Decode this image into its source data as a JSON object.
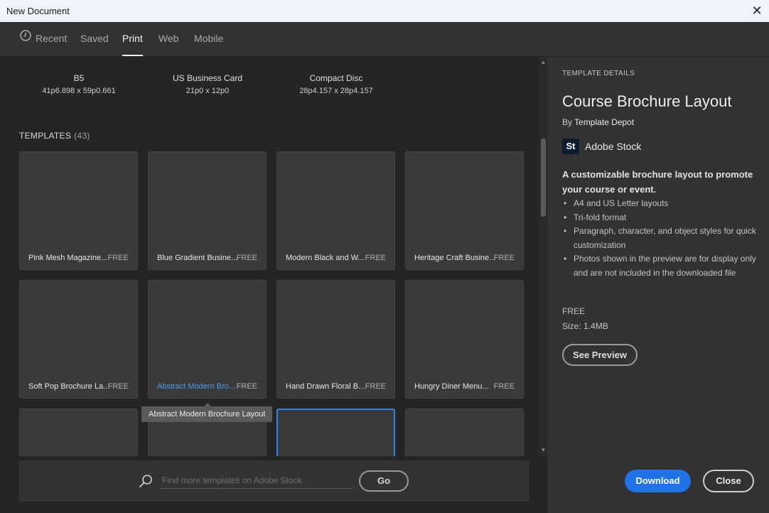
{
  "window": {
    "title": "New Document",
    "close_glyph": "✕"
  },
  "tabs": [
    {
      "label": "Recent",
      "icon": "clock-icon"
    },
    {
      "label": "Saved"
    },
    {
      "label": "Print",
      "active": true
    },
    {
      "label": "Web"
    },
    {
      "label": "Mobile"
    }
  ],
  "presets": [
    {
      "name": "B5",
      "size": "41p6.898 x 59p0.661"
    },
    {
      "name": "US Business Card",
      "size": "21p0 x 12p0"
    },
    {
      "name": "Compact Disc",
      "size": "28p4.157 x 28p4.157"
    }
  ],
  "templates": {
    "label": "TEMPLATES",
    "count": "(43)",
    "items": [
      {
        "name": "Pink Mesh Magazine...",
        "price": "FREE"
      },
      {
        "name": "Blue Gradient Busine...",
        "price": "FREE"
      },
      {
        "name": "Modern Black and W...",
        "price": "FREE"
      },
      {
        "name": "Heritage Craft Busine...",
        "price": "FREE"
      },
      {
        "name": "Soft Pop Brochure La...",
        "price": "FREE"
      },
      {
        "name": "Abstract Modern Bro...",
        "price": "FREE",
        "hovered": true
      },
      {
        "name": "Hand Drawn Floral B...",
        "price": "FREE"
      },
      {
        "name": "Hungry Diner Menu...",
        "price": "FREE"
      }
    ],
    "tooltip": "Abstract Modern Brochure Layout"
  },
  "search": {
    "placeholder": "Find more templates on Adobe Stock",
    "value": "",
    "go_label": "Go"
  },
  "details": {
    "section_label": "TEMPLATE DETAILS",
    "title": "Course Brochure Layout",
    "by_prefix": "By",
    "author": "Template Depot",
    "brand_logo": "St",
    "brand_name": "Adobe Stock",
    "description": "A customizable brochure layout to promote your course or event.",
    "bullets": [
      "A4 and US Letter layouts",
      "Tri-fold format",
      "Paragraph, character, and object styles for quick customization",
      "Photos shown in the preview are for display only and are not included in the downloaded file"
    ],
    "price": "FREE",
    "size": "Size: 1.4MB",
    "preview_label": "See Preview"
  },
  "actions": {
    "download_label": "Download",
    "close_label": "Close"
  },
  "colors": {
    "accent": "#1f73e6",
    "hover_text": "#4b9cf0",
    "selection_border": "#2f83e8"
  }
}
